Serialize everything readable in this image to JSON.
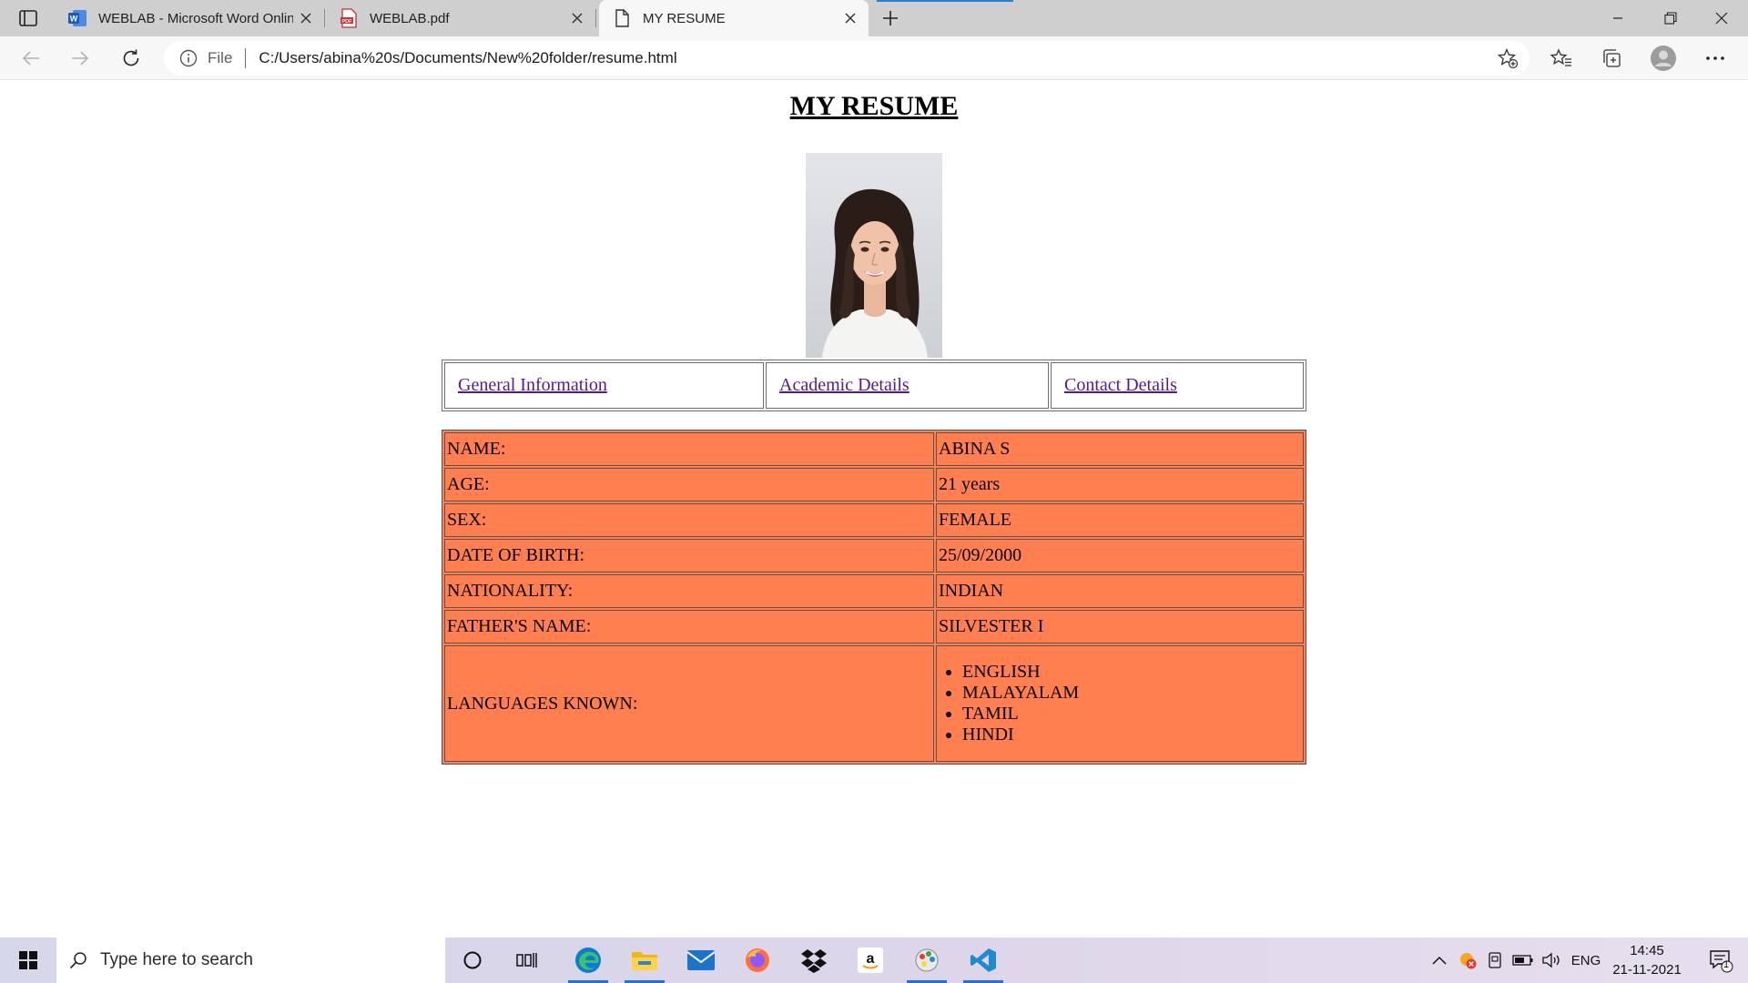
{
  "browser": {
    "tabs": [
      {
        "title": "WEBLAB - Microsoft Word Online",
        "favicon": "word-icon",
        "active": false
      },
      {
        "title": "WEBLAB.pdf",
        "favicon": "pdf-icon",
        "active": false
      },
      {
        "title": "MY RESUME",
        "favicon": "page-icon",
        "active": true
      }
    ],
    "address": {
      "scheme_label": "File",
      "url": "C:/Users/abina%20s/Documents/New%20folder/resume.html"
    }
  },
  "page": {
    "title": "MY RESUME",
    "nav_links": [
      "General Information",
      "Academic Details",
      "Contact Details"
    ],
    "info_rows": [
      {
        "label": "NAME:",
        "value": "ABINA S"
      },
      {
        "label": "AGE:",
        "value": "21 years"
      },
      {
        "label": "SEX:",
        "value": "FEMALE"
      },
      {
        "label": "DATE OF BIRTH:",
        "value": "25/09/2000"
      },
      {
        "label": "NATIONALITY:",
        "value": "INDIAN"
      },
      {
        "label": "FATHER'S NAME:",
        "value": "SILVESTER I"
      }
    ],
    "languages": {
      "label": "LANGUAGES KNOWN:",
      "items": [
        "ENGLISH",
        "MALAYALAM",
        "TAMIL",
        "HINDI"
      ]
    },
    "table_color": "#ff7f50"
  },
  "taskbar": {
    "search_placeholder": "Type here to search",
    "language": "ENG",
    "time": "14:45",
    "date": "21-11-2021",
    "notification_count": "1"
  }
}
